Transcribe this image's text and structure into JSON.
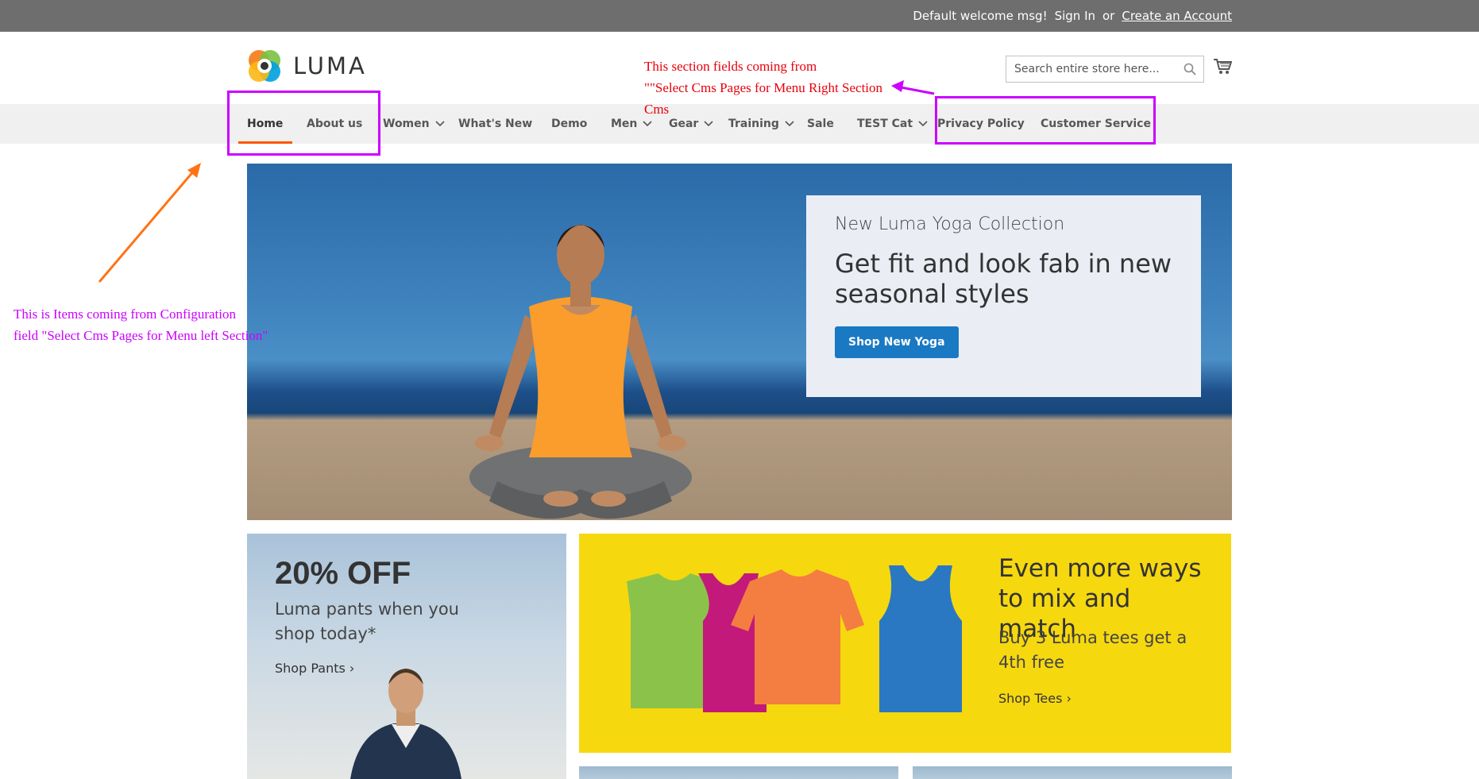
{
  "topbar": {
    "welcome": "Default welcome msg!",
    "signin": "Sign In",
    "or": "or",
    "create": "Create an Account"
  },
  "header": {
    "logo_text": "LUMA",
    "search_placeholder": "Search entire store here...",
    "cart_icon": "cart-icon",
    "search_icon": "search-icon"
  },
  "nav": [
    {
      "label": "Home"
    },
    {
      "label": "About us"
    },
    {
      "label": "Women"
    },
    {
      "label": "What's New"
    },
    {
      "label": "Demo"
    },
    {
      "label": "Men"
    },
    {
      "label": "Gear"
    },
    {
      "label": "Training"
    },
    {
      "label": "Sale"
    },
    {
      "label": "TEST Cat"
    },
    {
      "label": "Privacy Policy"
    },
    {
      "label": "Customer Service"
    }
  ],
  "hero": {
    "kicker": "New Luma Yoga Collection",
    "headline": "Get fit and look fab in new seasonal styles",
    "button": "Shop New Yoga"
  },
  "promo_left": {
    "title": "20% OFF",
    "subtitle": "Luma pants when you shop today*",
    "link": "Shop Pants ›"
  },
  "promo_right": {
    "title": "Even more ways to mix and match",
    "subtitle": "Buy 3 Luma tees get a 4th free",
    "link": "Shop Tees ›"
  },
  "annotations": {
    "right_line1": "This section fields coming from",
    "right_line2": "\"\"Select Cms Pages for Menu Right Section",
    "right_line3": "Cms",
    "left_line1": "This is Items coming from Configuration",
    "left_line2": "field \"Select Cms Pages for Menu left Section\""
  },
  "colors": {
    "accent": "#ff5501",
    "button": "#1979c3",
    "annotation_purple": "#cc00ff",
    "annotation_red": "#e8000b",
    "annotation_orange": "#ff7314",
    "promo_yellow": "#f6d80f"
  }
}
